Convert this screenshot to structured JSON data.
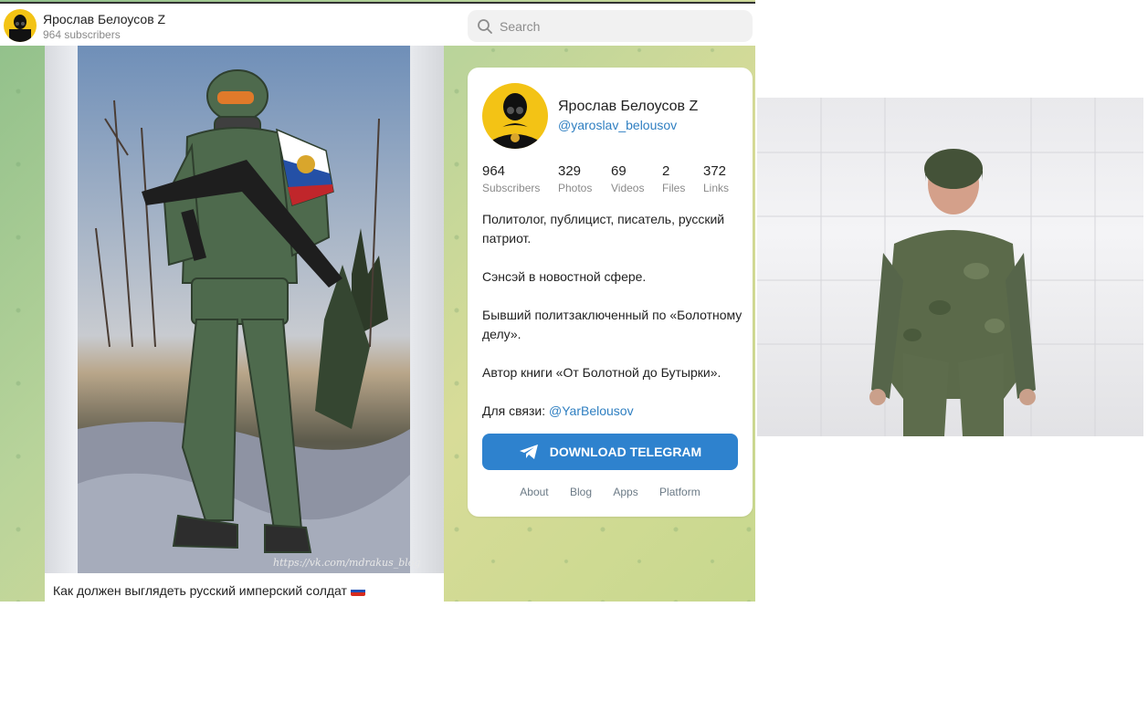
{
  "channel": {
    "name": "Ярослав Белоусов Z",
    "subscribers_label": "964 subscribers"
  },
  "search": {
    "placeholder": "Search"
  },
  "post": {
    "caption": "Как должен выглядеть русский имперский солдат",
    "watermark": "https://vk.com/mdrakus_blog"
  },
  "card": {
    "name": "Ярослав Белоусов Z",
    "username": "@yaroslav_belousov",
    "stats": [
      {
        "value": "964",
        "label": "Subscribers"
      },
      {
        "value": "329",
        "label": "Photos"
      },
      {
        "value": "69",
        "label": "Videos"
      },
      {
        "value": "2",
        "label": "Files"
      },
      {
        "value": "372",
        "label": "Links"
      }
    ],
    "about": {
      "p1": "Политолог, публицист, писатель, русский патриот.",
      "p2": "Сэнсэй в новостной сфере.",
      "p3": "Бывший политзаключенный по «Болотному делу».",
      "p4": "Автор книги «От Болотной до Бутырки».",
      "contact_prefix": "Для связи: ",
      "contact_link": "@YarBelousov"
    },
    "download_label": "DOWNLOAD TELEGRAM",
    "footer": [
      "About",
      "Blog",
      "Apps",
      "Platform"
    ]
  },
  "colors": {
    "accent": "#2e82ce",
    "link": "#2f7fc1"
  }
}
